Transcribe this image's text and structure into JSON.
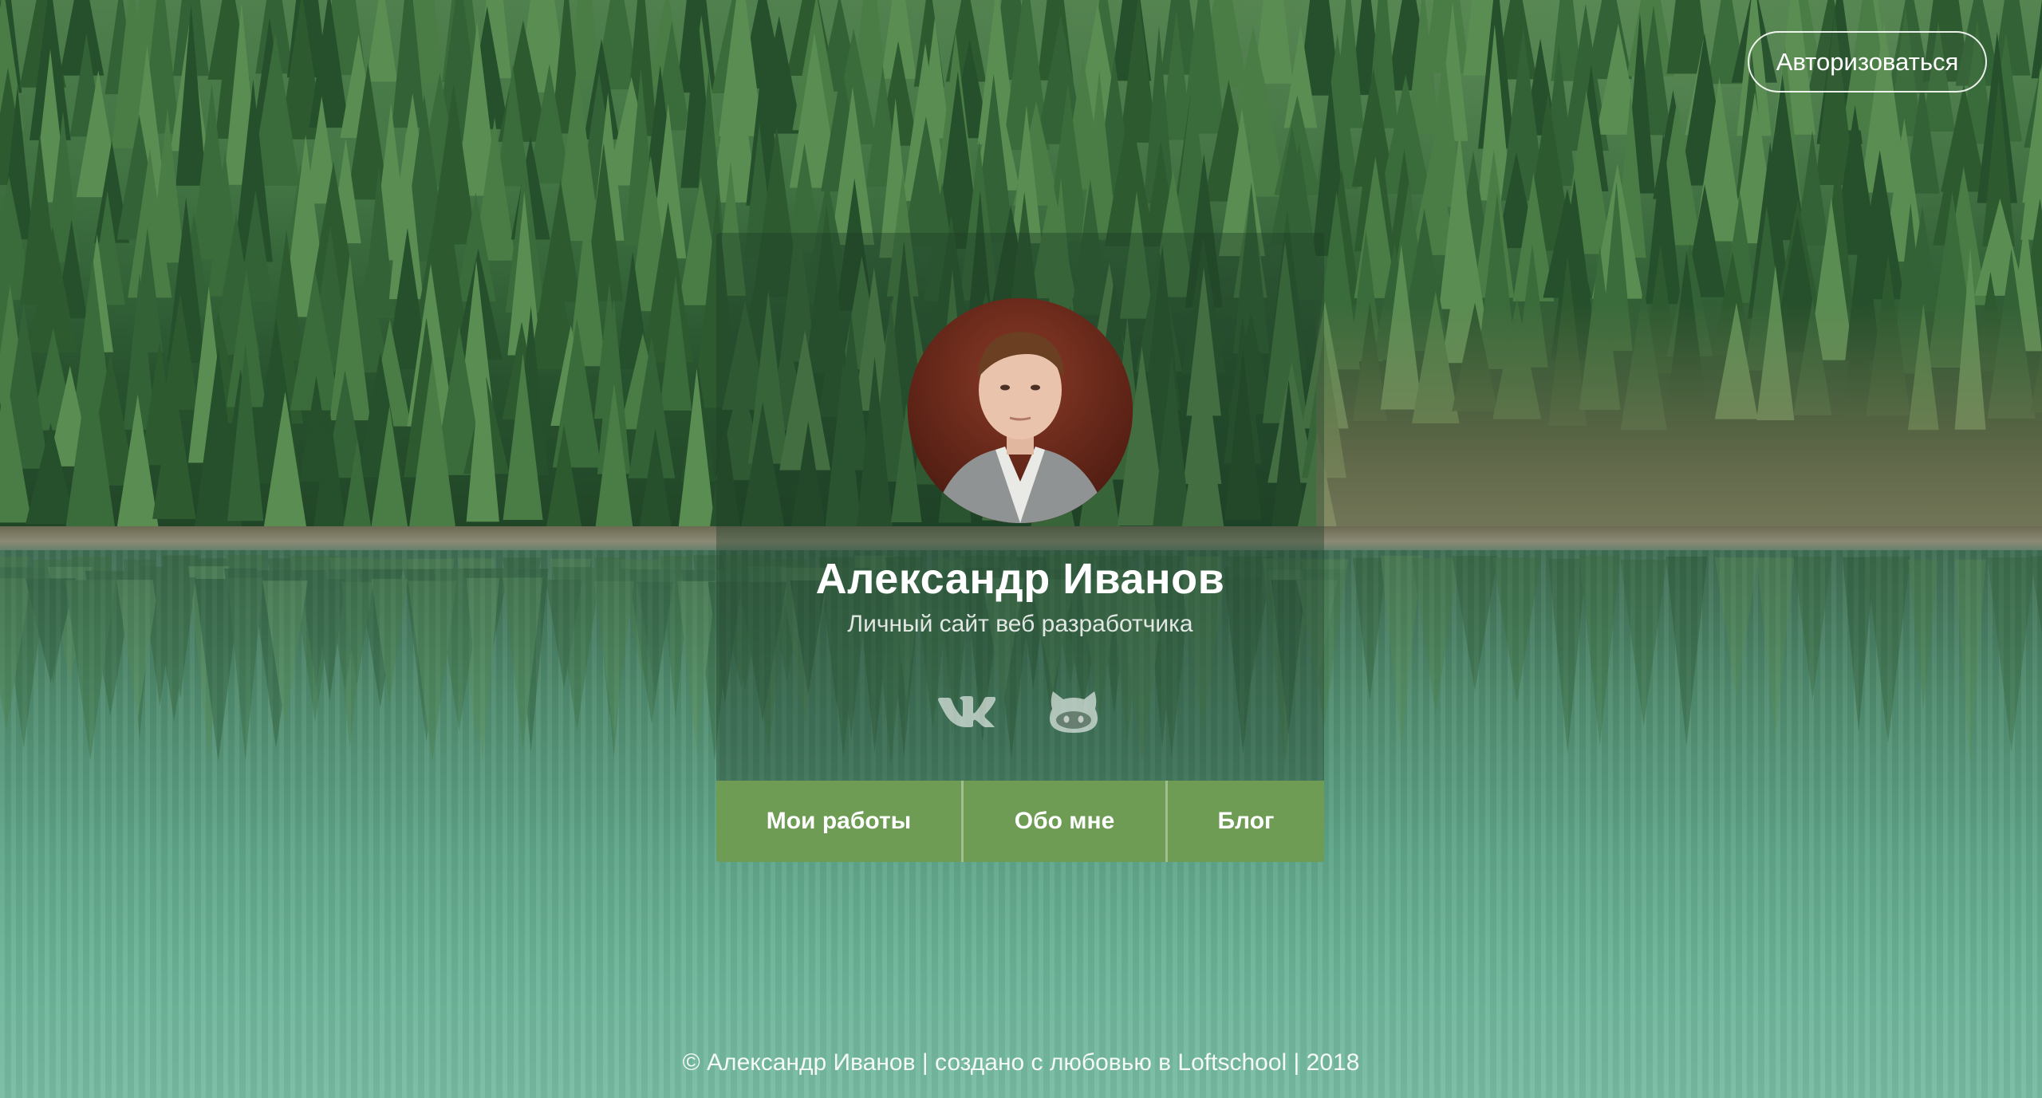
{
  "header": {
    "auth_label": "Авторизоваться"
  },
  "card": {
    "name": "Александр Иванов",
    "subtitle": "Личный сайт веб разработчика",
    "socials": [
      {
        "icon": "vk-icon"
      },
      {
        "icon": "github-icon"
      }
    ],
    "nav": [
      {
        "label": "Мои работы"
      },
      {
        "label": "Обо мне"
      },
      {
        "label": "Блог"
      }
    ]
  },
  "footer": {
    "text": "© Александр Иванов | создано с любовью в Loftschool | 2018"
  },
  "colors": {
    "nav_bg": "#6e9c55",
    "card_overlay": "rgba(30, 60, 40, 0.38)",
    "text": "#ffffff"
  }
}
